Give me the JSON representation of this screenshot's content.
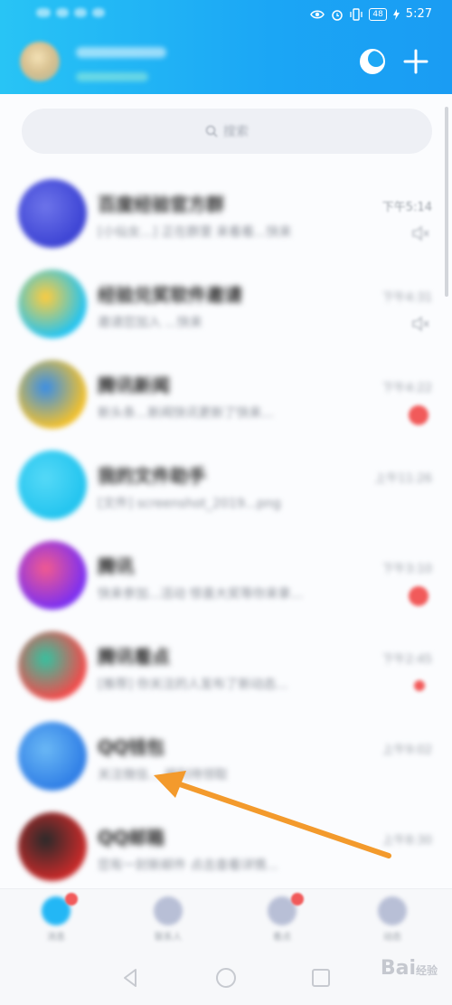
{
  "status_bar": {
    "battery": "48",
    "time": "5:27"
  },
  "header": {
    "moon_icon": "moon-theme-icon",
    "plus_icon": "plus-icon"
  },
  "search": {
    "placeholder": "搜索"
  },
  "conversations": [
    {
      "name": "百度经验官方群",
      "preview": "[小仙女...] 正在群里 来看看...快来",
      "time": "下午5:14",
      "avatar_colors": [
        "#3c43d4",
        "#6d74ea"
      ],
      "indicator": "mute"
    },
    {
      "name": "经验兑奖软件邀请",
      "preview": "邀请您加入 ...快来",
      "time": "下午4:31",
      "avatar_colors": [
        "#23c4f2",
        "#ffcc3e"
      ],
      "indicator": "mute"
    },
    {
      "name": "腾讯新闻",
      "preview": "新头条...新闻快讯更新了快来...",
      "time": "下午4:22",
      "avatar_colors": [
        "#f2c12e",
        "#3a8ee6"
      ],
      "indicator": "badge"
    },
    {
      "name": "我的文件助手",
      "preview": "[文件] screenshot_2019...png",
      "time": "上午11:26",
      "avatar_colors": [
        "#22c4ef",
        "#55d9f7"
      ],
      "indicator": "none"
    },
    {
      "name": "腾讯",
      "preview": "快来参加...活动 惊喜大奖等你来拿...",
      "time": "下午3:10",
      "avatar_colors": [
        "#7b2ff2",
        "#f25a8f"
      ],
      "indicator": "badge"
    },
    {
      "name": "腾讯看点",
      "preview": "[推荐] 你关注的人发布了新动态...",
      "time": "下午2:45",
      "avatar_colors": [
        "#f24b4b",
        "#35c2a0"
      ],
      "indicator": "small-badge"
    },
    {
      "name": "QQ钱包",
      "preview": "关注微信... 福利待领取",
      "time": "上午9:02",
      "avatar_colors": [
        "#2f7ee6",
        "#6ab8f5"
      ],
      "indicator": "none"
    },
    {
      "name": "QQ邮箱",
      "preview": "您有一封新邮件 点击查看详情...",
      "time": "上午8:30",
      "avatar_colors": [
        "#c92a2a",
        "#2a2a2a"
      ],
      "indicator": "none"
    }
  ],
  "tabs": [
    {
      "id": "messages",
      "label": "消息",
      "color": "#23b7f5",
      "dot": true
    },
    {
      "id": "contacts",
      "label": "联系人",
      "color": "#b8bfd6",
      "dot": false
    },
    {
      "id": "watch",
      "label": "看点",
      "color": "#b8bfd6",
      "dot": true
    },
    {
      "id": "dynamic",
      "label": "动态",
      "color": "#b8bfd6",
      "dot": false
    }
  ],
  "watermark": {
    "brand": "Bai",
    "suffix": "经验"
  },
  "annotation": {
    "arrow_color": "#f39a2c"
  }
}
